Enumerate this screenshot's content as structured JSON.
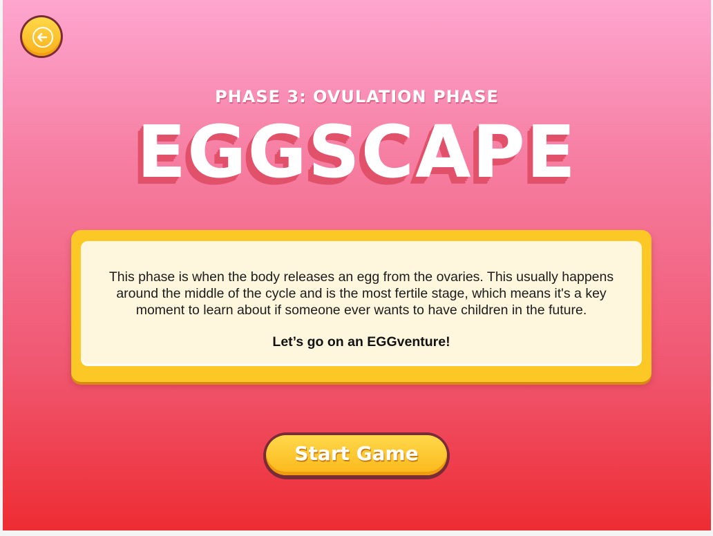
{
  "back_button": {
    "icon": "arrow-left-icon"
  },
  "header": {
    "phase_label": "PHASE 3: OVULATION PHASE",
    "game_title": "EGGSCAPE"
  },
  "info_panel": {
    "description": "This phase is when the body releases an egg from the ovaries. This usually happens around the middle of the cycle and is the most fertile stage, which means it's a key moment to learn about if someone ever wants to have children in the future.",
    "call_to_action": "Let’s go on an EGGventure!"
  },
  "start_button": {
    "label": "Start Game"
  },
  "colors": {
    "background_top": "#fea6cf",
    "background_bottom": "#ee2c33",
    "accent_yellow": "#fcc826",
    "panel_cream": "#fef7dd",
    "title_shadow": "#e2516a",
    "button_outline": "#7a2c36"
  }
}
